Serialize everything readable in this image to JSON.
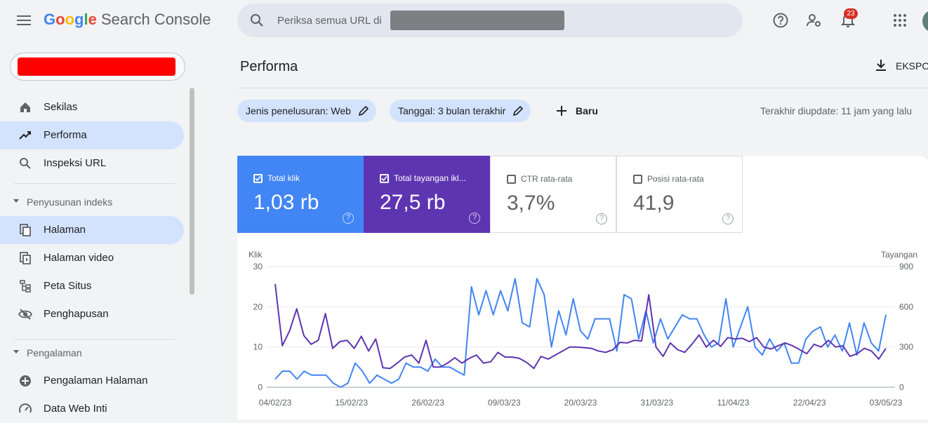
{
  "app": {
    "logo_google": "Google",
    "logo_product": "Search Console",
    "search_placeholder": "Periksa semua URL di",
    "notification_count": "23"
  },
  "sidebar": {
    "items_top": [
      {
        "label": "Sekilas",
        "icon": "home-icon"
      },
      {
        "label": "Performa",
        "icon": "trending-icon",
        "active": true
      },
      {
        "label": "Inspeksi URL",
        "icon": "search-icon"
      }
    ],
    "section_index": "Penyusunan indeks",
    "items_index": [
      {
        "label": "Halaman",
        "icon": "pages-icon",
        "active": true
      },
      {
        "label": "Halaman video",
        "icon": "video-pages-icon"
      },
      {
        "label": "Peta Situs",
        "icon": "sitemap-icon"
      },
      {
        "label": "Penghapusan",
        "icon": "removal-icon"
      }
    ],
    "section_experience": "Pengalaman",
    "items_experience": [
      {
        "label": "Pengalaman Halaman",
        "icon": "page-experience-icon"
      },
      {
        "label": "Data Web Inti",
        "icon": "core-web-vitals-icon"
      }
    ]
  },
  "main": {
    "title": "Performa",
    "export_label": "EKSPOR",
    "filters": [
      {
        "label": "Jenis penelusuran: Web"
      },
      {
        "label": "Tanggal: 3 bulan terakhir"
      }
    ],
    "new_filter_label": "Baru",
    "last_updated": "Terakhir diupdate: 11 jam yang lalu",
    "metrics": [
      {
        "label": "Total klik",
        "value": "1,03 rb",
        "checked": true,
        "color": "#4285f4"
      },
      {
        "label": "Total tayangan ikl...",
        "value": "27,5 rb",
        "checked": true,
        "color": "#5e35b1"
      },
      {
        "label": "CTR rata-rata",
        "value": "3,7%",
        "checked": false,
        "color": "#ffffff"
      },
      {
        "label": "Posisi rata-rata",
        "value": "41,9",
        "checked": false,
        "color": "#ffffff"
      }
    ]
  },
  "chart_data": {
    "type": "line",
    "left_axis_title": "Klik",
    "right_axis_title": "Tayangan",
    "left_ticks": [
      "30",
      "20",
      "10",
      "0"
    ],
    "right_ticks": [
      "900",
      "600",
      "300",
      "0"
    ],
    "x_tick_labels": [
      "04/02/23",
      "15/02/23",
      "26/02/23",
      "09/03/23",
      "20/03/23",
      "31/03/23",
      "11/04/23",
      "22/04/23",
      "03/05/23"
    ],
    "ylim_left": [
      0,
      30
    ],
    "ylim_right": [
      0,
      900
    ],
    "series": [
      {
        "name": "Total klik",
        "axis": "left",
        "color": "#4285f4",
        "values": [
          2,
          4,
          4,
          2,
          4,
          3,
          3,
          3,
          1,
          0,
          1,
          6,
          4,
          1,
          3,
          2,
          1,
          2,
          6,
          5,
          5,
          4,
          7,
          5,
          5,
          4,
          3,
          25,
          18,
          24,
          18,
          24,
          19,
          27,
          16,
          15,
          27,
          23,
          10,
          19,
          13,
          22,
          14,
          12,
          17,
          17,
          17,
          9,
          23,
          22,
          12,
          19,
          11,
          17,
          12,
          15,
          18,
          17,
          17,
          13,
          10,
          11,
          22,
          10,
          15,
          20,
          10,
          8,
          12,
          9,
          11,
          6,
          6,
          12,
          14,
          15,
          10,
          13,
          9,
          16,
          8,
          16,
          11,
          9,
          18
        ]
      },
      {
        "name": "Total tayangan iklan",
        "axis": "right",
        "color": "#5e35b1",
        "values": [
          770,
          310,
          420,
          585,
          385,
          320,
          350,
          550,
          290,
          340,
          350,
          290,
          380,
          270,
          360,
          145,
          140,
          180,
          225,
          240,
          180,
          350,
          150,
          150,
          180,
          220,
          180,
          215,
          240,
          180,
          190,
          260,
          225,
          225,
          215,
          185,
          140,
          230,
          210,
          240,
          270,
          300,
          300,
          295,
          290,
          270,
          260,
          280,
          335,
          330,
          350,
          345,
          690,
          300,
          230,
          330,
          280,
          260,
          320,
          390,
          300,
          350,
          305,
          370,
          360,
          365,
          340,
          370,
          300,
          285,
          310,
          330,
          310,
          280,
          250,
          320,
          300,
          350,
          300,
          310,
          230,
          250,
          290,
          270,
          210,
          290
        ]
      }
    ]
  }
}
